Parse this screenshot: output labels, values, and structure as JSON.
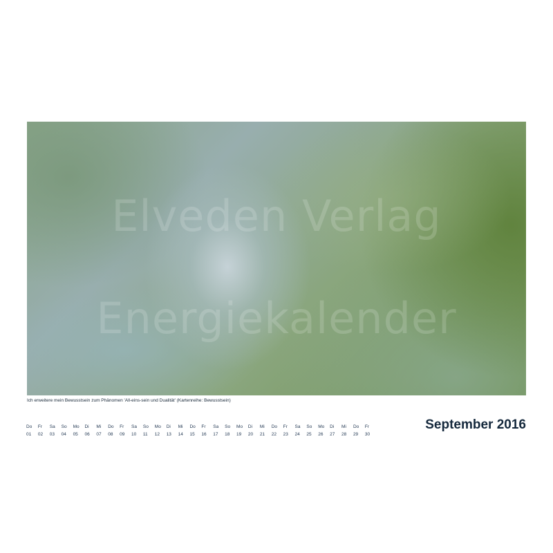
{
  "photo": {
    "watermark_line1": "Elveden Verlag",
    "watermark_line2": "Energiekalender"
  },
  "caption": "Ich erweitere mein Bewusstsein zum Phänomen 'All-eins-sein und Dualität' (Kartenreihe: Bewusstsein)",
  "month_title": "September 2016",
  "days": [
    {
      "wd": "Do",
      "num": "01"
    },
    {
      "wd": "Fr",
      "num": "02"
    },
    {
      "wd": "Sa",
      "num": "03"
    },
    {
      "wd": "So",
      "num": "04"
    },
    {
      "wd": "Mo",
      "num": "05"
    },
    {
      "wd": "Di",
      "num": "06"
    },
    {
      "wd": "Mi",
      "num": "07"
    },
    {
      "wd": "Do",
      "num": "08"
    },
    {
      "wd": "Fr",
      "num": "09"
    },
    {
      "wd": "Sa",
      "num": "10"
    },
    {
      "wd": "So",
      "num": "11"
    },
    {
      "wd": "Mo",
      "num": "12"
    },
    {
      "wd": "Di",
      "num": "13"
    },
    {
      "wd": "Mi",
      "num": "14"
    },
    {
      "wd": "Do",
      "num": "15"
    },
    {
      "wd": "Fr",
      "num": "16"
    },
    {
      "wd": "Sa",
      "num": "17"
    },
    {
      "wd": "So",
      "num": "18"
    },
    {
      "wd": "Mo",
      "num": "19"
    },
    {
      "wd": "Di",
      "num": "20"
    },
    {
      "wd": "Mi",
      "num": "21"
    },
    {
      "wd": "Do",
      "num": "22"
    },
    {
      "wd": "Fr",
      "num": "23"
    },
    {
      "wd": "Sa",
      "num": "24"
    },
    {
      "wd": "So",
      "num": "25"
    },
    {
      "wd": "Mo",
      "num": "26"
    },
    {
      "wd": "Di",
      "num": "27"
    },
    {
      "wd": "Mi",
      "num": "28"
    },
    {
      "wd": "Do",
      "num": "29"
    },
    {
      "wd": "Fr",
      "num": "30"
    }
  ]
}
